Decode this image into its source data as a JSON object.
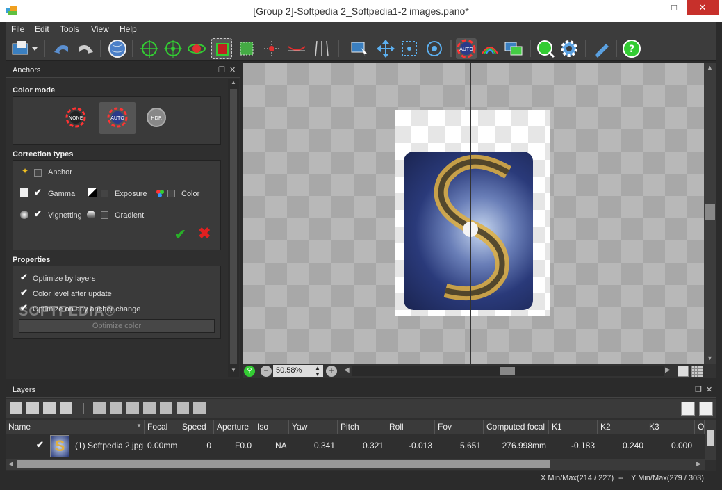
{
  "window": {
    "title": "[Group 2]-Softpedia 2_Softpedia1-2 images.pano*",
    "min_icon": "minimize-icon",
    "max_icon": "maximize-icon",
    "close_icon": "close-icon"
  },
  "menu": [
    "File",
    "Edit",
    "Tools",
    "View",
    "Help"
  ],
  "anchors_panel": {
    "title": "Anchors",
    "color_mode": {
      "label": "Color mode",
      "options": [
        "NONE",
        "AUTO",
        "HDR"
      ],
      "selected": "AUTO"
    },
    "correction_types": {
      "label": "Correction types",
      "anchor": "Anchor",
      "gamma": "Gamma",
      "exposure": "Exposure",
      "color": "Color",
      "vignetting": "Vignetting",
      "gradient": "Gradient"
    },
    "properties": {
      "label": "Properties",
      "opt1": "Optimize by layers",
      "opt2": "Color level after update",
      "opt3": "Optimize on any anchor change",
      "button": "Optimize color"
    }
  },
  "canvas": {
    "zoom": "50.58%",
    "watermark": "SOFTPEDIA®"
  },
  "layers": {
    "title": "Layers",
    "columns": [
      "Name",
      "Focal",
      "Speed",
      "Aperture",
      "Iso",
      "Yaw",
      "Pitch",
      "Roll",
      "Fov",
      "Computed focal",
      "K1",
      "K2",
      "K3",
      "O"
    ],
    "row": {
      "name": "(1) Softpedia 2.jpg",
      "focal": "0.00mm",
      "speed": "0",
      "aperture": "F0.0",
      "iso": "NA",
      "yaw": "0.341",
      "pitch": "0.321",
      "roll": "-0.013",
      "fov": "5.651",
      "computed_focal": "276.998mm",
      "k1": "-0.183",
      "k2": "0.240",
      "k3": "0.000"
    }
  },
  "status": {
    "x": "X Min/Max(214 / 227)",
    "sep": "--",
    "y": "Y Min/Max(279 / 303)"
  },
  "colors": {
    "accent": "#3aa0d8",
    "confirm": "#28b028",
    "cancel": "#e02020"
  }
}
